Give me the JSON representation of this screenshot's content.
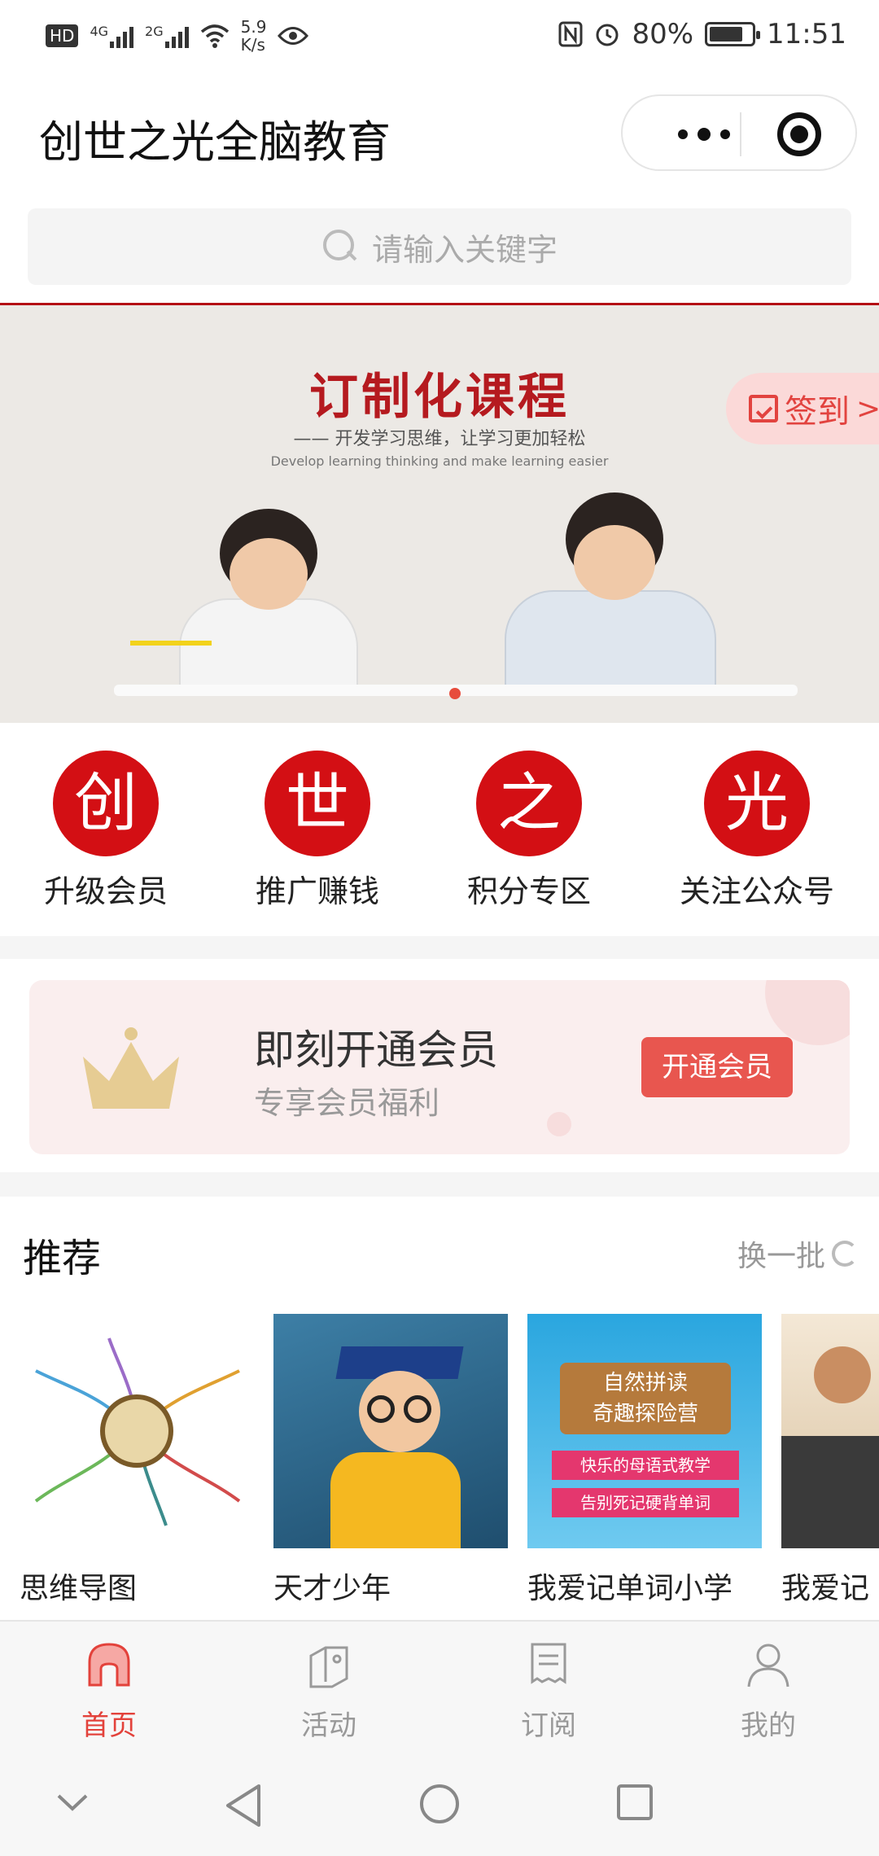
{
  "status_bar": {
    "hd": "HD",
    "net1": "4G",
    "net2": "2G",
    "speed_top": "5.9",
    "speed_bottom": "K/s",
    "battery": "80%",
    "time": "11:51",
    "battery_level": 0.8
  },
  "header": {
    "title": "创世之光全脑教育"
  },
  "search": {
    "placeholder": "请输入关键字"
  },
  "banner": {
    "headline": "订制化课程",
    "subtitle": "—— 开发学习思维，让学习更加轻松",
    "subtitle_en": "Develop learning thinking and make learning easier",
    "checkin_label": "签到",
    "checkin_arrow": ">"
  },
  "quick_links": [
    {
      "char": "创",
      "label": "升级会员"
    },
    {
      "char": "世",
      "label": "推广赚钱"
    },
    {
      "char": "之",
      "label": "积分专区"
    },
    {
      "char": "光",
      "label": "关注公众号"
    }
  ],
  "member_card": {
    "title": "即刻开通会员",
    "subtitle": "专享会员福利",
    "button": "开通会员"
  },
  "recommend": {
    "title": "推荐",
    "refresh_label": "换一批",
    "items": [
      {
        "title": "思维导图"
      },
      {
        "title": "天才少年"
      },
      {
        "title": "我爱记单词小学",
        "image_text_1": "自然拼读",
        "image_text_2": "奇趣探险营",
        "image_text_3": "快乐的母语式教学",
        "image_text_4": "告别死记硬背单词"
      },
      {
        "title": "我爱记"
      }
    ]
  },
  "tabbar": [
    {
      "label": "首页",
      "icon": "home-icon",
      "active": true
    },
    {
      "label": "活动",
      "icon": "activity-icon",
      "active": false
    },
    {
      "label": "订阅",
      "icon": "subscribe-icon",
      "active": false
    },
    {
      "label": "我的",
      "icon": "profile-icon",
      "active": false
    }
  ],
  "colors": {
    "brand_red": "#d30f14",
    "accent": "#e3423b",
    "member_button": "#e8564f"
  }
}
